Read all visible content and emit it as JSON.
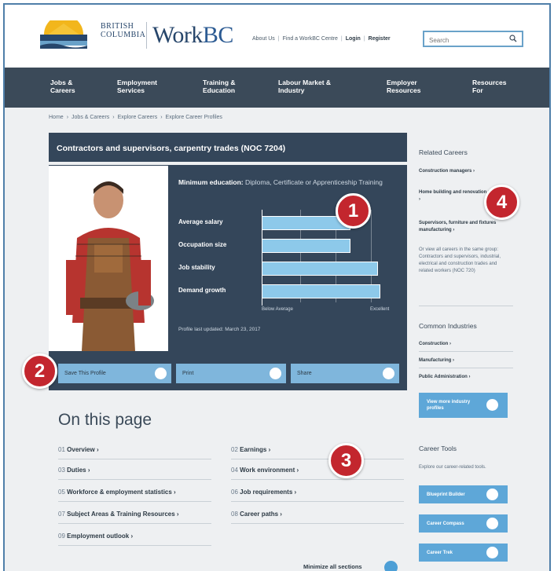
{
  "header": {
    "logo_province": "BRITISH\nCOLUMBIA",
    "logo_work": "Work",
    "logo_bc": "BC",
    "links": [
      "About Us",
      "Find a WorkBC Centre",
      "Login",
      "Register"
    ],
    "search_placeholder": "Search"
  },
  "nav": {
    "items": [
      {
        "label": "Jobs &\nCareers"
      },
      {
        "label": "Employment\nServices"
      },
      {
        "label": "Training &\nEducation"
      },
      {
        "label": "Labour Market &\nIndustry"
      },
      {
        "label": "Employer\nResources"
      },
      {
        "label": "Resources\nFor"
      }
    ]
  },
  "breadcrumb": [
    "Home",
    "Jobs & Careers",
    "Explore Careers",
    "Explore Career Profiles"
  ],
  "profile": {
    "title": "Contractors and supervisors, carpentry trades (NOC 7204)",
    "min_edu_label": "Minimum education:",
    "min_edu_value": "Diploma, Certificate or Apprenticeship Training",
    "metrics": [
      {
        "label": "Average salary",
        "value": 0.67
      },
      {
        "label": "Occupation size",
        "value": 0.67
      },
      {
        "label": "Job stability",
        "value": 0.88
      },
      {
        "label": "Demand growth",
        "value": 0.9
      }
    ],
    "axis_left": "Below Average",
    "axis_right": "Excellent",
    "updated": "Profile last updated: March 23, 2017"
  },
  "actions": [
    {
      "label": "Save This Profile",
      "icon": "save-icon"
    },
    {
      "label": "Print",
      "icon": "print-icon"
    },
    {
      "label": "Share",
      "icon": "mail-icon"
    }
  ],
  "on_this_page": {
    "title": "On this page",
    "links": [
      {
        "num": "01",
        "label": "Overview"
      },
      {
        "num": "02",
        "label": "Earnings"
      },
      {
        "num": "03",
        "label": "Duties"
      },
      {
        "num": "04",
        "label": "Work environment"
      },
      {
        "num": "05",
        "label": "Workforce & employment statistics"
      },
      {
        "num": "06",
        "label": "Job requirements"
      },
      {
        "num": "07",
        "label": "Subject Areas & Training Resources"
      },
      {
        "num": "08",
        "label": "Career paths"
      },
      {
        "num": "09",
        "label": "Employment outlook"
      }
    ],
    "minimize": "Minimize all sections"
  },
  "sidebar": {
    "related_title": "Related Careers",
    "related": [
      "Construction managers",
      "Home building and renovation managers",
      "Supervisors, furniture and fixtures manufacturing"
    ],
    "group_note": "Or view all careers in the same group: Contractors and supervisors, industrial, electrical and construction trades and related workers (NOC 720)",
    "industries_title": "Common Industries",
    "industries": [
      "Construction",
      "Manufacturing",
      "Public Administration"
    ],
    "industry_btn": "View more industry profiles",
    "tools_title": "Career Tools",
    "tools_note": "Explore our career-related tools.",
    "tools": [
      "Blueprint Builder",
      "Career Compass",
      "Career Trek"
    ]
  },
  "callouts": [
    "1",
    "2",
    "3",
    "4"
  ],
  "colors": {
    "nav_bg": "#3b4a59",
    "card_bg": "#34465a",
    "accent_blue": "#5ea7d8",
    "callout_red": "#c3262e"
  }
}
